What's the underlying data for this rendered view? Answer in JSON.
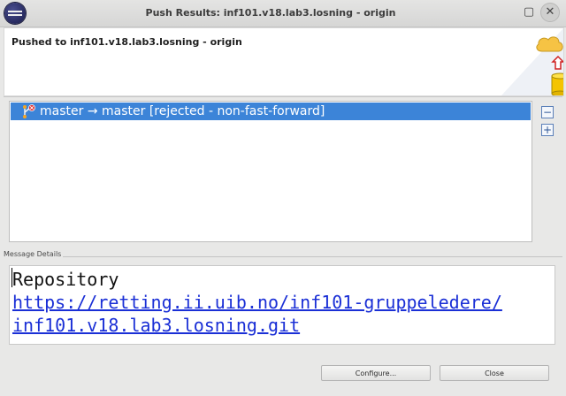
{
  "window": {
    "title": "Push Results: inf101.v18.lab3.losning - origin",
    "maximize_glyph": "▢",
    "close_glyph": "✕"
  },
  "header": {
    "text": "Pushed to inf101.v18.lab3.losning - origin"
  },
  "results": {
    "rows": [
      {
        "label": "master → master [rejected - non-fast-forward]",
        "icon": "rejected-branch-icon",
        "selected": true
      }
    ],
    "collapse_glyph": "−",
    "expand_glyph": "+"
  },
  "message_details": {
    "label": "Message Details",
    "heading": "Repository",
    "link_line1": "https://retting.ii.uib.no/inf101-gruppeledere/",
    "link_line2": "inf101.v18.lab3.losning.git"
  },
  "buttons": {
    "configure": "Configure...",
    "close": "Close"
  },
  "colors": {
    "selection": "#3c84d8",
    "link": "#1a2fd6",
    "background": "#e8e8e7"
  }
}
